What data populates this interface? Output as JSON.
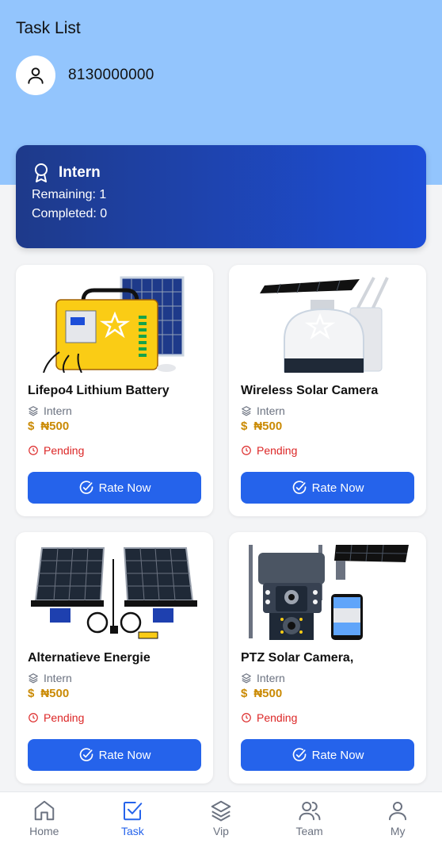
{
  "header": {
    "title": "Task List"
  },
  "user": {
    "phone": "8130000000"
  },
  "level": {
    "name": "Intern",
    "remaining": "Remaining: 1",
    "completed": "Completed: 0"
  },
  "colors": {
    "header_bg": "#93c5fd",
    "primary": "#2563eb",
    "price": "#ca8a04",
    "pending": "#dc2626"
  },
  "products": [
    {
      "name": "Lifepo4 Lithium Battery",
      "level": "Intern",
      "currency": "$",
      "price": "₦500",
      "status": "Pending",
      "button": "Rate Now",
      "image": "solar-battery-station"
    },
    {
      "name": "Wireless Solar Camera",
      "level": "Intern",
      "currency": "$",
      "price": "₦500",
      "status": "Pending",
      "button": "Rate Now",
      "image": "solar-dome-camera"
    },
    {
      "name": "Alternatieve Energie",
      "level": "Intern",
      "currency": "$",
      "price": "₦500",
      "status": "Pending",
      "button": "Rate Now",
      "image": "solar-panel-kit"
    },
    {
      "name": "PTZ Solar Camera,",
      "level": "Intern",
      "currency": "$",
      "price": "₦500",
      "status": "Pending",
      "button": "Rate Now",
      "image": "ptz-solar-camera"
    }
  ],
  "tabs": [
    {
      "label": "Home",
      "icon": "home-icon"
    },
    {
      "label": "Task",
      "icon": "task-icon",
      "active": true
    },
    {
      "label": "Vip",
      "icon": "layers-icon"
    },
    {
      "label": "Team",
      "icon": "team-icon"
    },
    {
      "label": "My",
      "icon": "user-icon"
    }
  ]
}
